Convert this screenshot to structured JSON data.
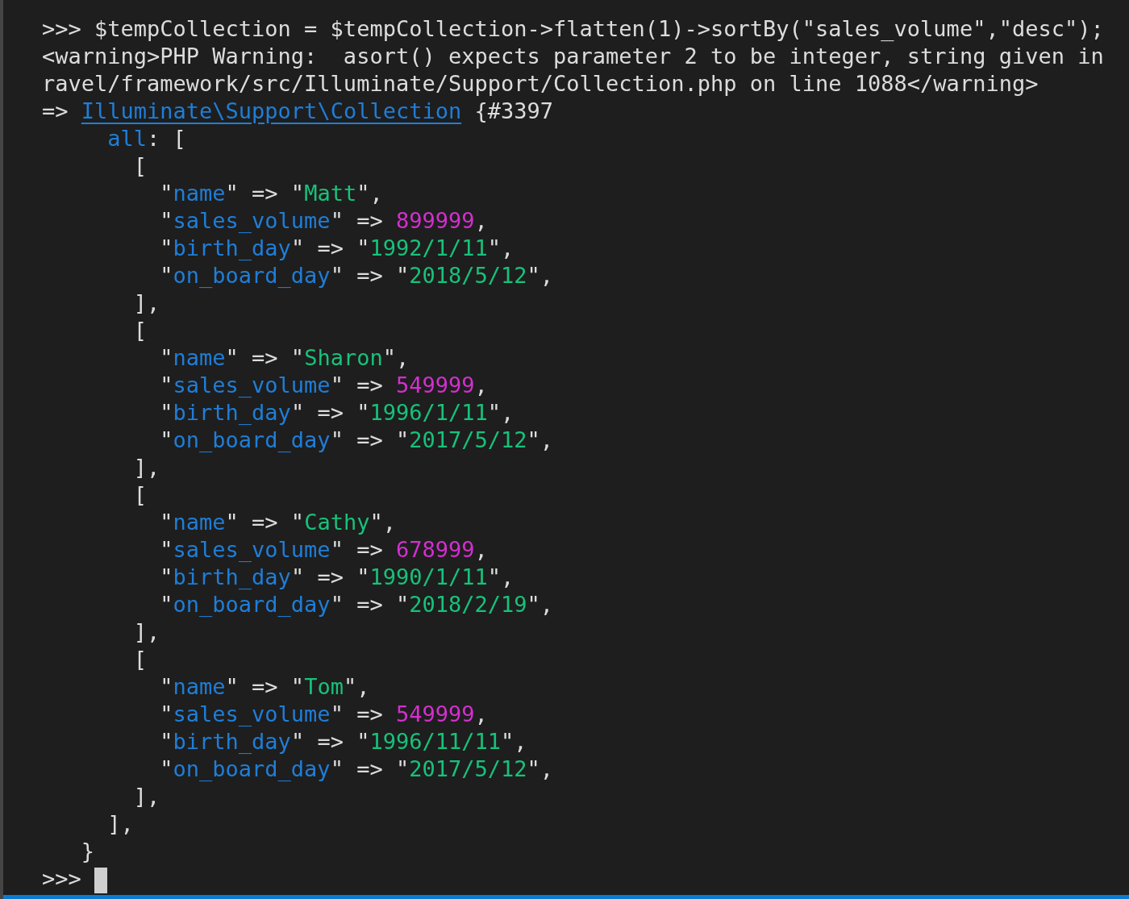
{
  "terminal": {
    "lines": [
      {
        "segments": [
          {
            "text": ">>> $tempCollection = $tempCollection->flatten(1)->sortBy(\"sales_volume\",\"desc\");",
            "kind": "plain"
          }
        ]
      },
      {
        "segments": [
          {
            "text": "<warning>PHP Warning:  asort() expects parameter 2 to be integer, string given in",
            "kind": "plain"
          }
        ]
      },
      {
        "segments": [
          {
            "text": "ravel/framework/src/Illuminate/Support/Collection.php on line 1088</warning>",
            "kind": "plain"
          }
        ]
      },
      {
        "segments": [
          {
            "text": "=> ",
            "kind": "plain"
          },
          {
            "text": "Illuminate\\Support\\Collection",
            "kind": "link"
          },
          {
            "text": " {#3397",
            "kind": "plain"
          }
        ],
        "children": [
          {
            "segments": [
              {
                "text": "all",
                "kind": "key"
              },
              {
                "text": ": [",
                "kind": "plain"
              }
            ],
            "children": [
              {
                "segments": [
                  {
                    "text": "[",
                    "kind": "plain"
                  }
                ],
                "children": [
                  {
                    "segments": [
                      {
                        "text": "\"",
                        "kind": "plain"
                      },
                      {
                        "text": "name",
                        "kind": "key"
                      },
                      {
                        "text": "\" => \"",
                        "kind": "plain"
                      },
                      {
                        "text": "Matt",
                        "kind": "string"
                      },
                      {
                        "text": "\",",
                        "kind": "plain"
                      }
                    ]
                  },
                  {
                    "segments": [
                      {
                        "text": "\"",
                        "kind": "plain"
                      },
                      {
                        "text": "sales_volume",
                        "kind": "key"
                      },
                      {
                        "text": "\" => ",
                        "kind": "plain"
                      },
                      {
                        "text": "899999",
                        "kind": "number"
                      },
                      {
                        "text": ",",
                        "kind": "plain"
                      }
                    ]
                  },
                  {
                    "segments": [
                      {
                        "text": "\"",
                        "kind": "plain"
                      },
                      {
                        "text": "birth_day",
                        "kind": "key"
                      },
                      {
                        "text": "\" => \"",
                        "kind": "plain"
                      },
                      {
                        "text": "1992/1/11",
                        "kind": "string"
                      },
                      {
                        "text": "\",",
                        "kind": "plain"
                      }
                    ]
                  },
                  {
                    "segments": [
                      {
                        "text": "\"",
                        "kind": "plain"
                      },
                      {
                        "text": "on_board_day",
                        "kind": "key"
                      },
                      {
                        "text": "\" => \"",
                        "kind": "plain"
                      },
                      {
                        "text": "2018/5/12",
                        "kind": "string"
                      },
                      {
                        "text": "\",",
                        "kind": "plain"
                      }
                    ]
                  }
                ]
              },
              {
                "segments": [
                  {
                    "text": "],",
                    "kind": "plain"
                  }
                ]
              },
              {
                "segments": [
                  {
                    "text": "[",
                    "kind": "plain"
                  }
                ],
                "children": [
                  {
                    "segments": [
                      {
                        "text": "\"",
                        "kind": "plain"
                      },
                      {
                        "text": "name",
                        "kind": "key"
                      },
                      {
                        "text": "\" => \"",
                        "kind": "plain"
                      },
                      {
                        "text": "Sharon",
                        "kind": "string"
                      },
                      {
                        "text": "\",",
                        "kind": "plain"
                      }
                    ]
                  },
                  {
                    "segments": [
                      {
                        "text": "\"",
                        "kind": "plain"
                      },
                      {
                        "text": "sales_volume",
                        "kind": "key"
                      },
                      {
                        "text": "\" => ",
                        "kind": "plain"
                      },
                      {
                        "text": "549999",
                        "kind": "number"
                      },
                      {
                        "text": ",",
                        "kind": "plain"
                      }
                    ]
                  },
                  {
                    "segments": [
                      {
                        "text": "\"",
                        "kind": "plain"
                      },
                      {
                        "text": "birth_day",
                        "kind": "key"
                      },
                      {
                        "text": "\" => \"",
                        "kind": "plain"
                      },
                      {
                        "text": "1996/1/11",
                        "kind": "string"
                      },
                      {
                        "text": "\",",
                        "kind": "plain"
                      }
                    ]
                  },
                  {
                    "segments": [
                      {
                        "text": "\"",
                        "kind": "plain"
                      },
                      {
                        "text": "on_board_day",
                        "kind": "key"
                      },
                      {
                        "text": "\" => \"",
                        "kind": "plain"
                      },
                      {
                        "text": "2017/5/12",
                        "kind": "string"
                      },
                      {
                        "text": "\",",
                        "kind": "plain"
                      }
                    ]
                  }
                ]
              },
              {
                "segments": [
                  {
                    "text": "],",
                    "kind": "plain"
                  }
                ]
              },
              {
                "segments": [
                  {
                    "text": "[",
                    "kind": "plain"
                  }
                ],
                "children": [
                  {
                    "segments": [
                      {
                        "text": "\"",
                        "kind": "plain"
                      },
                      {
                        "text": "name",
                        "kind": "key"
                      },
                      {
                        "text": "\" => \"",
                        "kind": "plain"
                      },
                      {
                        "text": "Cathy",
                        "kind": "string"
                      },
                      {
                        "text": "\",",
                        "kind": "plain"
                      }
                    ]
                  },
                  {
                    "segments": [
                      {
                        "text": "\"",
                        "kind": "plain"
                      },
                      {
                        "text": "sales_volume",
                        "kind": "key"
                      },
                      {
                        "text": "\" => ",
                        "kind": "plain"
                      },
                      {
                        "text": "678999",
                        "kind": "number"
                      },
                      {
                        "text": ",",
                        "kind": "plain"
                      }
                    ]
                  },
                  {
                    "segments": [
                      {
                        "text": "\"",
                        "kind": "plain"
                      },
                      {
                        "text": "birth_day",
                        "kind": "key"
                      },
                      {
                        "text": "\" => \"",
                        "kind": "plain"
                      },
                      {
                        "text": "1990/1/11",
                        "kind": "string"
                      },
                      {
                        "text": "\",",
                        "kind": "plain"
                      }
                    ]
                  },
                  {
                    "segments": [
                      {
                        "text": "\"",
                        "kind": "plain"
                      },
                      {
                        "text": "on_board_day",
                        "kind": "key"
                      },
                      {
                        "text": "\" => \"",
                        "kind": "plain"
                      },
                      {
                        "text": "2018/2/19",
                        "kind": "string"
                      },
                      {
                        "text": "\",",
                        "kind": "plain"
                      }
                    ]
                  }
                ]
              },
              {
                "segments": [
                  {
                    "text": "],",
                    "kind": "plain"
                  }
                ]
              },
              {
                "segments": [
                  {
                    "text": "[",
                    "kind": "plain"
                  }
                ],
                "children": [
                  {
                    "segments": [
                      {
                        "text": "\"",
                        "kind": "plain"
                      },
                      {
                        "text": "name",
                        "kind": "key"
                      },
                      {
                        "text": "\" => \"",
                        "kind": "plain"
                      },
                      {
                        "text": "Tom",
                        "kind": "string"
                      },
                      {
                        "text": "\",",
                        "kind": "plain"
                      }
                    ]
                  },
                  {
                    "segments": [
                      {
                        "text": "\"",
                        "kind": "plain"
                      },
                      {
                        "text": "sales_volume",
                        "kind": "key"
                      },
                      {
                        "text": "\" => ",
                        "kind": "plain"
                      },
                      {
                        "text": "549999",
                        "kind": "number"
                      },
                      {
                        "text": ",",
                        "kind": "plain"
                      }
                    ]
                  },
                  {
                    "segments": [
                      {
                        "text": "\"",
                        "kind": "plain"
                      },
                      {
                        "text": "birth_day",
                        "kind": "key"
                      },
                      {
                        "text": "\" => \"",
                        "kind": "plain"
                      },
                      {
                        "text": "1996/11/11",
                        "kind": "string"
                      },
                      {
                        "text": "\",",
                        "kind": "plain"
                      }
                    ]
                  },
                  {
                    "segments": [
                      {
                        "text": "\"",
                        "kind": "plain"
                      },
                      {
                        "text": "on_board_day",
                        "kind": "key"
                      },
                      {
                        "text": "\" => \"",
                        "kind": "plain"
                      },
                      {
                        "text": "2017/5/12",
                        "kind": "string"
                      },
                      {
                        "text": "\",",
                        "kind": "plain"
                      }
                    ]
                  }
                ]
              },
              {
                "segments": [
                  {
                    "text": "],",
                    "kind": "plain"
                  }
                ]
              }
            ]
          },
          {
            "segments": [
              {
                "text": "],",
                "kind": "plain"
              }
            ]
          },
          {
            "segments": [
              {
                "text": "}",
                "kind": "plain"
              }
            ],
            "outdent": true
          }
        ]
      },
      {
        "segments": [
          {
            "text": ">>>",
            "kind": "plain"
          }
        ],
        "cursor": true
      }
    ]
  }
}
